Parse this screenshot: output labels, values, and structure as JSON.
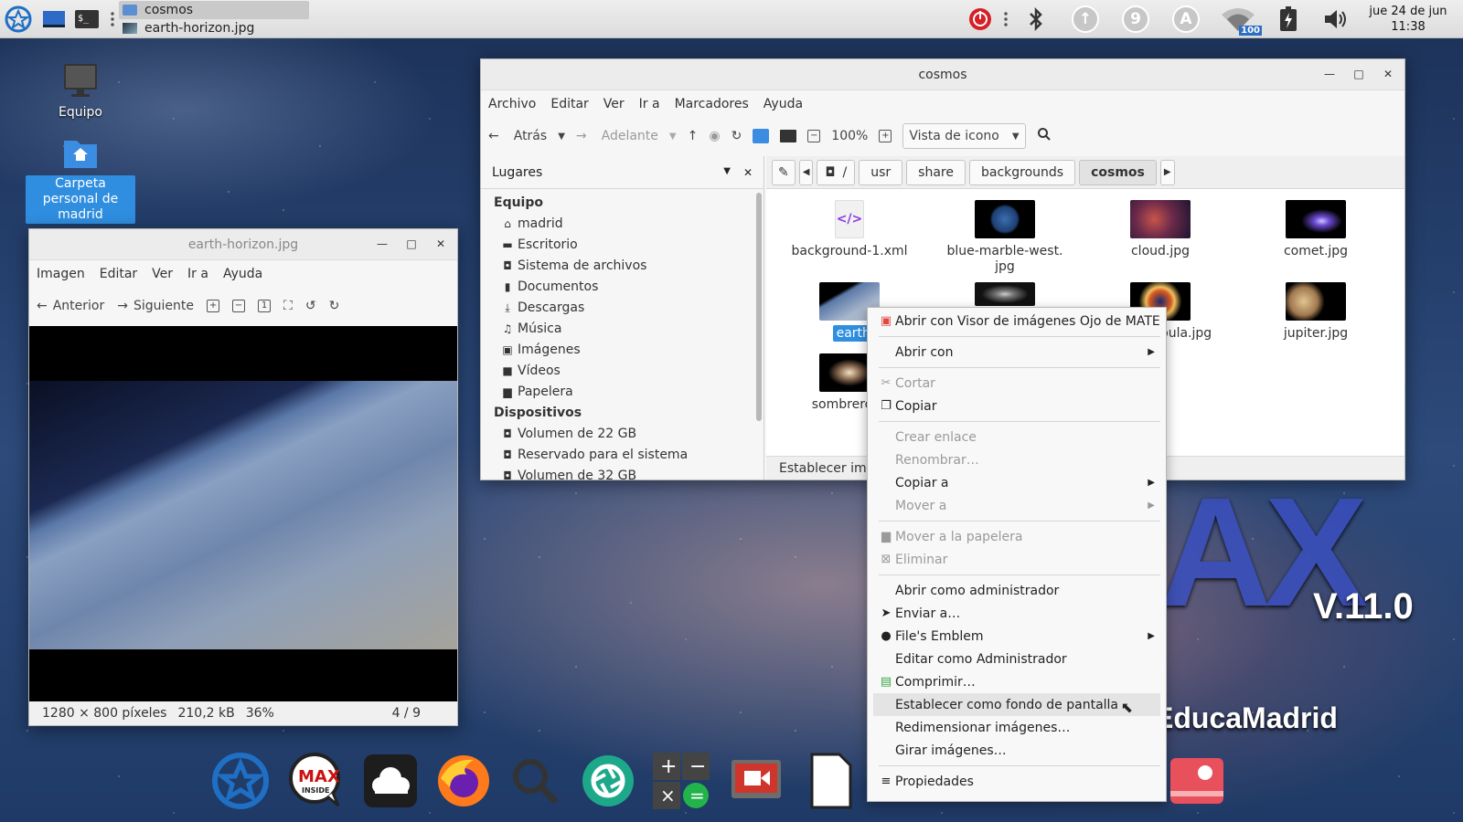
{
  "top_panel": {
    "tasks": [
      {
        "label": "cosmos",
        "active": true
      },
      {
        "label": "earth-horizon.jpg",
        "active": false
      }
    ],
    "tray": {
      "battery_level": "100",
      "indicator_9": "9",
      "indicator_a": "A"
    },
    "clock": {
      "date": "jue 24 de jun",
      "time": "11:38"
    }
  },
  "desktop": {
    "icons": [
      {
        "label": "Equipo"
      },
      {
        "label": "Carpeta personal de madrid"
      }
    ],
    "branding": {
      "version": "V.11.0",
      "name": "EducaMadrid",
      "logo_letters": "AX"
    }
  },
  "image_viewer": {
    "title": "earth-horizon.jpg",
    "menu": [
      "Imagen",
      "Editar",
      "Ver",
      "Ir a",
      "Ayuda"
    ],
    "toolbar": {
      "prev": "Anterior",
      "next": "Siguiente"
    },
    "status": {
      "dimensions": "1280 × 800 píxeles",
      "size": "210,2 kB",
      "zoom": "36%",
      "position": "4 / 9"
    }
  },
  "file_manager": {
    "title": "cosmos",
    "menu": [
      "Archivo",
      "Editar",
      "Ver",
      "Ir a",
      "Marcadores",
      "Ayuda"
    ],
    "toolbar": {
      "back": "Atrás",
      "forward": "Adelante",
      "zoom": "100%",
      "view_mode": "Vista de icono"
    },
    "sidebar": {
      "header": "Lugares",
      "sections": [
        {
          "title": "Equipo",
          "items": [
            "madrid",
            "Escritorio",
            "Sistema de archivos",
            "Documentos",
            "Descargas",
            "Música",
            "Imágenes",
            "Vídeos",
            "Papelera"
          ]
        },
        {
          "title": "Dispositivos",
          "items": [
            "Volumen de 22 GB",
            "Reservado para el sistema",
            "Volumen de 32 GB"
          ]
        }
      ]
    },
    "path": {
      "root": "/",
      "segments": [
        "usr",
        "share",
        "backgrounds",
        "cosmos"
      ]
    },
    "files": [
      {
        "name": "background-1.xml"
      },
      {
        "name": "blue-marble-west.\njpg"
      },
      {
        "name": "cloud.jpg"
      },
      {
        "name": "comet.jpg"
      },
      {
        "name": "earth-horiz"
      },
      {
        "name": ""
      },
      {
        "name": "bula.jpg"
      },
      {
        "name": "jupiter.jpg"
      },
      {
        "name": "sombrero"
      }
    ],
    "statusbar": "Establecer ima"
  },
  "context_menu": {
    "items": [
      {
        "label": "Abrir con Visor de imágenes Ojo de MATE",
        "icon": "image-viewer-icon",
        "disabled": false,
        "submenu": false
      },
      {
        "sep": true
      },
      {
        "label": "Abrir con",
        "disabled": false,
        "submenu": true
      },
      {
        "sep": true
      },
      {
        "label": "Cortar",
        "icon": "scissors-icon",
        "disabled": true,
        "submenu": false
      },
      {
        "label": "Copiar",
        "icon": "copy-icon",
        "disabled": false,
        "submenu": false
      },
      {
        "sep": true
      },
      {
        "label": "Crear enlace",
        "disabled": true,
        "submenu": false
      },
      {
        "label": "Renombrar…",
        "disabled": true,
        "submenu": false
      },
      {
        "label": "Copiar a",
        "disabled": false,
        "submenu": true
      },
      {
        "label": "Mover a",
        "disabled": true,
        "submenu": true
      },
      {
        "sep": true
      },
      {
        "label": "Mover a la papelera",
        "icon": "trash-icon",
        "disabled": true,
        "submenu": false
      },
      {
        "label": "Eliminar",
        "icon": "delete-icon",
        "disabled": true,
        "submenu": false
      },
      {
        "sep": true
      },
      {
        "label": "Abrir como administrador",
        "disabled": false,
        "submenu": false
      },
      {
        "label": "Enviar a…",
        "icon": "send-icon",
        "disabled": false,
        "submenu": false
      },
      {
        "label": "File's Emblem",
        "icon": "emblem-icon",
        "disabled": false,
        "submenu": true
      },
      {
        "label": "Editar como Administrador",
        "disabled": false,
        "submenu": false
      },
      {
        "label": "Comprimir…",
        "icon": "archive-icon",
        "disabled": false,
        "submenu": false
      },
      {
        "label": "Establecer como fondo de pantalla",
        "disabled": false,
        "submenu": false,
        "highlighted": true
      },
      {
        "label": "Redimensionar imágenes…",
        "disabled": false,
        "submenu": false
      },
      {
        "label": "Girar imágenes…",
        "disabled": false,
        "submenu": false
      },
      {
        "sep": true
      },
      {
        "label": "Propiedades",
        "icon": "properties-icon",
        "disabled": false,
        "submenu": false
      }
    ]
  },
  "dock": {
    "apps": [
      "max-start-icon",
      "max-inside-icon",
      "cloud-icon",
      "firefox-icon",
      "search-icon",
      "camera-shutter-icon",
      "calculator-icon",
      "screen-recorder-icon",
      "document-icon",
      "photo-icon"
    ]
  }
}
